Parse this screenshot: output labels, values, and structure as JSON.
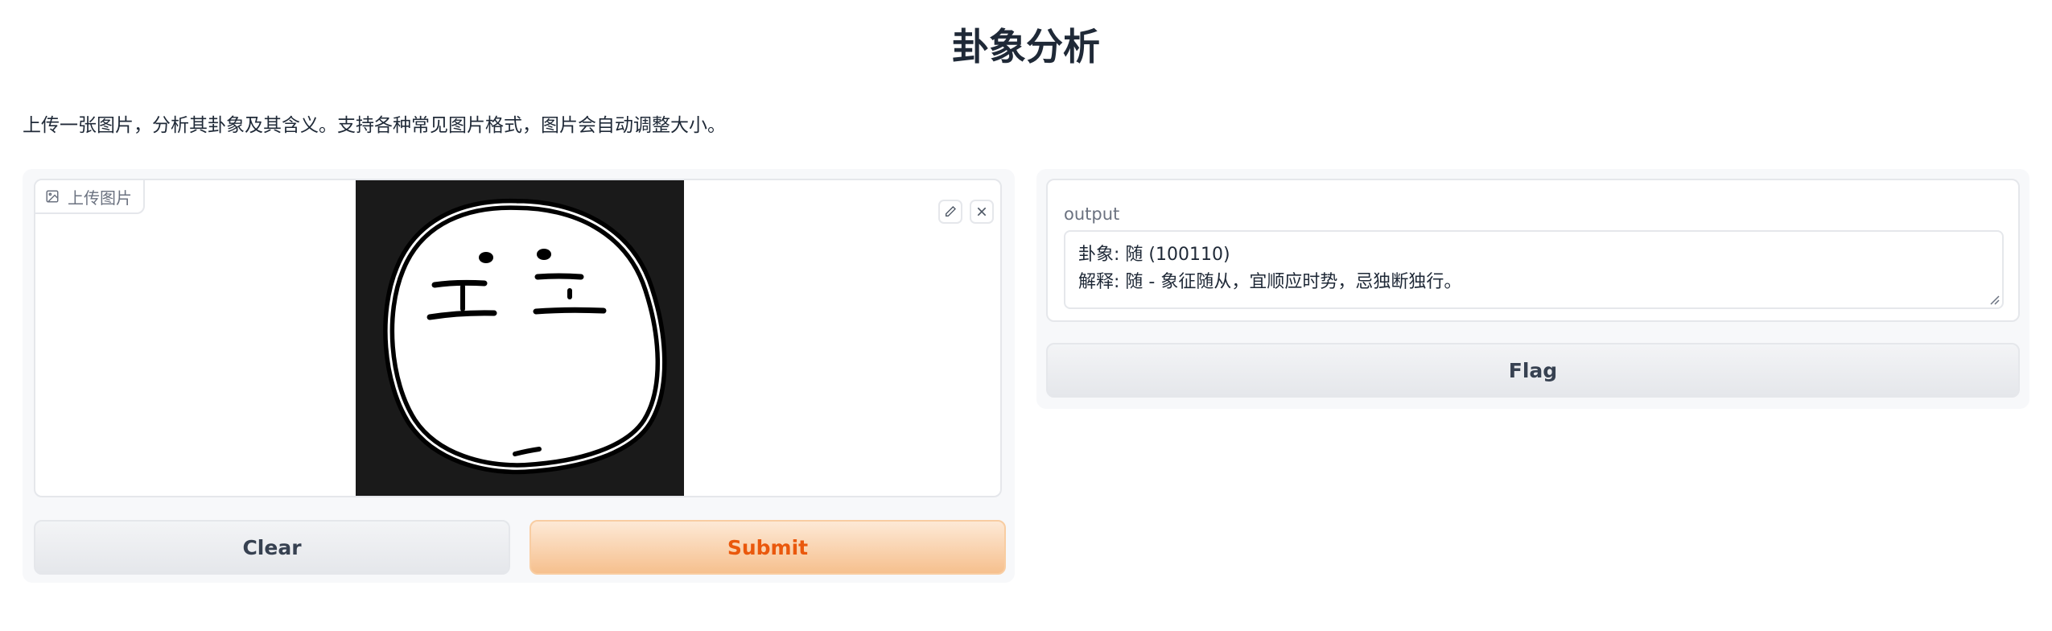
{
  "app": {
    "title": "卦象分析",
    "description": "上传一张图片，分析其卦象及其含义。支持各种常见图片格式，图片会自动调整大小。"
  },
  "input_panel": {
    "image_label": "上传图片",
    "image_icon": "image-icon",
    "edit_icon": "pencil-icon",
    "remove_icon": "close-icon",
    "clear_label": "Clear",
    "submit_label": "Submit"
  },
  "output_panel": {
    "label": "output",
    "line1": "卦象: 随 (100110)",
    "line2": "解释: 随 - 象征随从，宜顺应时势，忌独断独行。",
    "flag_label": "Flag"
  },
  "colors": {
    "accent": "#ea580c",
    "submit_bg": "#f6c08e"
  }
}
